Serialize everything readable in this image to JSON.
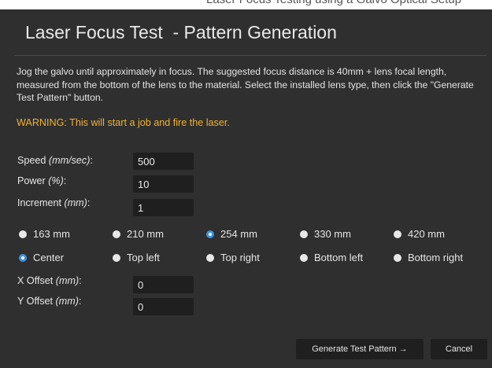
{
  "background_window": {
    "title_fragment": "Laser Focus Testing using a Galvo Optical Setup"
  },
  "dialog": {
    "title": "Laser Focus Test  - Pattern Generation",
    "description": "Jog the galvo until approximately in focus. The suggested focus distance is 40mm + lens focal length, measured from the bottom of the lens to the material. Select the installed lens type, then click the \"Generate Test Pattern\" button.",
    "warning": "WARNING: This will start a job and fire the laser."
  },
  "fields": {
    "speed": {
      "label": "Speed ",
      "unit": "(mm/sec)",
      "suffix": ":",
      "value": "500"
    },
    "power": {
      "label": "Power ",
      "unit": "(%)",
      "suffix": ":",
      "value": "10"
    },
    "increment": {
      "label": "Increment ",
      "unit": "(mm)",
      "suffix": ":",
      "value": "1"
    },
    "x_offset": {
      "label": "X Offset ",
      "unit": "(mm)",
      "suffix": ":",
      "value": "0"
    },
    "y_offset": {
      "label": "Y Offset ",
      "unit": "(mm)",
      "suffix": ":",
      "value": "0"
    }
  },
  "lens_options": [
    {
      "label": "163 mm",
      "checked": false
    },
    {
      "label": "210 mm",
      "checked": false
    },
    {
      "label": "254 mm",
      "checked": true
    },
    {
      "label": "330 mm",
      "checked": false
    },
    {
      "label": "420 mm",
      "checked": false
    }
  ],
  "position_options": [
    {
      "label": "Center",
      "checked": true
    },
    {
      "label": "Top left",
      "checked": false
    },
    {
      "label": "Top right",
      "checked": false
    },
    {
      "label": "Bottom left",
      "checked": false
    },
    {
      "label": "Bottom right",
      "checked": false
    }
  ],
  "buttons": {
    "generate": "Generate Test Pattern →",
    "cancel": "Cancel"
  },
  "colors": {
    "background": "#2f2f2f",
    "input_background": "#1f1f1f",
    "warning": "#f2b233",
    "radio_accent": "#3b93e4"
  }
}
